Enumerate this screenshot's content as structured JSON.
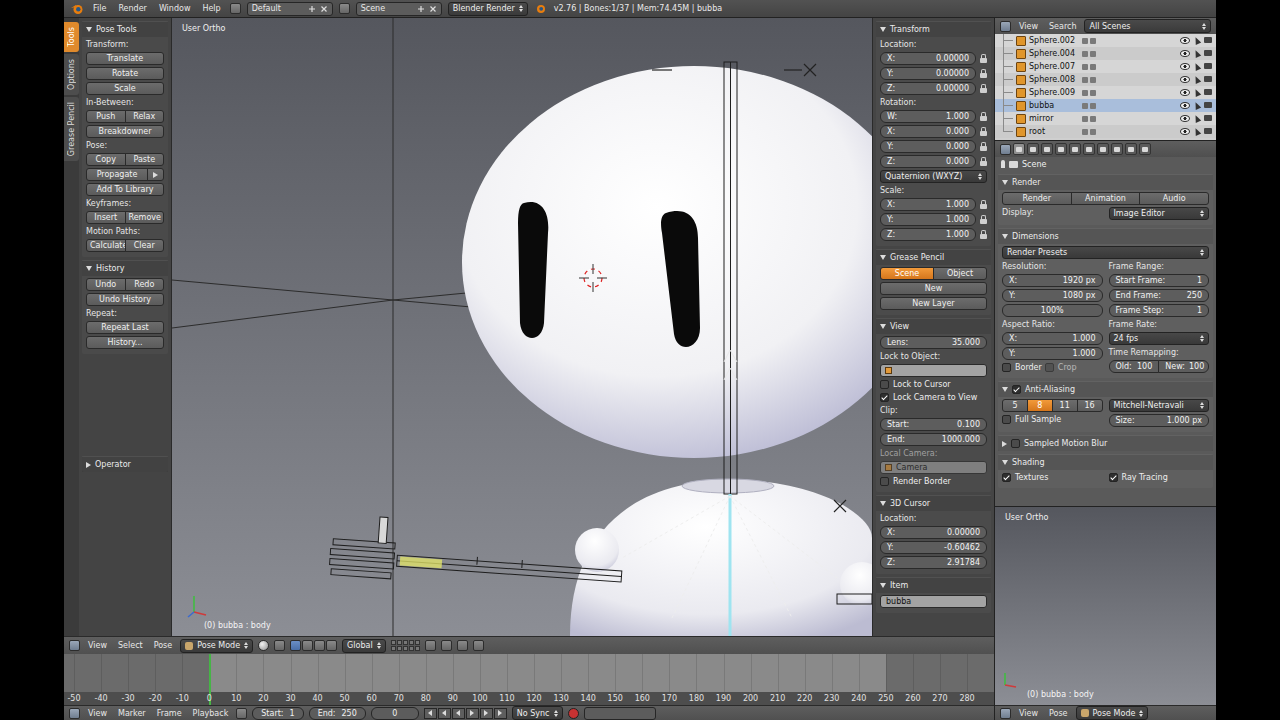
{
  "top_bar": {
    "menus": [
      "File",
      "Render",
      "Window",
      "Help"
    ],
    "layout": "Default",
    "scene": "Scene",
    "engine": "Blender Render",
    "info": "v2.76 | Bones:1/37 | Mem:74.45M | bubba"
  },
  "tool_tabs": [
    {
      "label": "Tools",
      "selected": true
    },
    {
      "label": "Options",
      "selected": false
    },
    {
      "label": "Grease Pencil",
      "selected": false
    }
  ],
  "tool_shelf": {
    "panels": [
      {
        "title": "Pose Tools",
        "expanded": true,
        "rows": [
          {
            "kind": "label",
            "text": "Transform:"
          },
          {
            "kind": "button",
            "text": "Translate",
            "selected": false
          },
          {
            "kind": "button",
            "text": "Rotate",
            "selected": false
          },
          {
            "kind": "button",
            "text": "Scale",
            "selected": false
          },
          {
            "kind": "label",
            "text": "In-Between:"
          },
          {
            "kind": "buttons",
            "items": [
              {
                "text": "Push",
                "selected": false
              },
              {
                "text": "Relax",
                "selected": false
              }
            ]
          },
          {
            "kind": "button",
            "text": "Breakdowner",
            "selected": false
          },
          {
            "kind": "label",
            "text": "Pose:"
          },
          {
            "kind": "buttons",
            "items": [
              {
                "text": "Copy",
                "selected": false
              },
              {
                "text": "Paste",
                "selected": false
              }
            ]
          },
          {
            "kind": "menu-button",
            "text": "Propagate"
          },
          {
            "kind": "button",
            "text": "Add To Library",
            "selected": false
          },
          {
            "kind": "label",
            "text": "Keyframes:"
          },
          {
            "kind": "buttons",
            "items": [
              {
                "text": "Insert",
                "selected": false
              },
              {
                "text": "Remove",
                "selected": false
              }
            ]
          },
          {
            "kind": "label",
            "text": "Motion Paths:"
          },
          {
            "kind": "buttons",
            "items": [
              {
                "text": "Calculate",
                "selected": false
              },
              {
                "text": "Clear",
                "selected": false
              }
            ]
          }
        ]
      },
      {
        "title": "History",
        "expanded": true,
        "rows": [
          {
            "kind": "buttons",
            "items": [
              {
                "text": "Undo",
                "selected": false
              },
              {
                "text": "Redo",
                "selected": false
              }
            ]
          },
          {
            "kind": "button",
            "text": "Undo History",
            "selected": false
          },
          {
            "kind": "label",
            "text": "Repeat:"
          },
          {
            "kind": "button",
            "text": "Repeat Last",
            "selected": false
          },
          {
            "kind": "button",
            "text": "History...",
            "selected": false
          }
        ]
      }
    ],
    "operator": {
      "title": "Operator",
      "expanded": false,
      "rows": []
    }
  },
  "viewport": {
    "title": "User Ortho",
    "status": "(0) bubba : body"
  },
  "n_panel": [
    {
      "title": "Transform",
      "expanded": true,
      "rows": [
        {
          "kind": "label",
          "text": "Location:"
        },
        {
          "kind": "field-lock",
          "label": "X:",
          "value": "0.00000"
        },
        {
          "kind": "field-lock",
          "label": "Y:",
          "value": "0.00000"
        },
        {
          "kind": "field-lock",
          "label": "Z:",
          "value": "0.00000"
        },
        {
          "kind": "label",
          "text": "Rotation:"
        },
        {
          "kind": "field-lock",
          "label": "W:",
          "value": "1.000"
        },
        {
          "kind": "field-lock",
          "label": "X:",
          "value": "0.000"
        },
        {
          "kind": "field-lock",
          "label": "Y:",
          "value": "0.000"
        },
        {
          "kind": "field-lock",
          "label": "Z:",
          "value": "0.000"
        },
        {
          "kind": "dropdown",
          "text": "Quaternion (WXYZ)"
        },
        {
          "kind": "label",
          "text": "Scale:"
        },
        {
          "kind": "field-lock",
          "label": "X:",
          "value": "1.000"
        },
        {
          "kind": "field-lock",
          "label": "Y:",
          "value": "1.000"
        },
        {
          "kind": "field-lock",
          "label": "Z:",
          "value": "1.000"
        }
      ]
    },
    {
      "title": "Grease Pencil",
      "expanded": true,
      "rows": [
        {
          "kind": "buttons",
          "items": [
            {
              "text": "Scene",
              "selected": true
            },
            {
              "text": "Object",
              "selected": false
            }
          ]
        },
        {
          "kind": "button",
          "text": "New",
          "selected": false
        },
        {
          "kind": "button",
          "text": "New Layer",
          "selected": false
        }
      ]
    },
    {
      "title": "View",
      "expanded": true,
      "rows": [
        {
          "kind": "field",
          "label": "Lens:",
          "value": "35.000"
        },
        {
          "kind": "label",
          "text": "Lock to Object:"
        },
        {
          "kind": "object-field",
          "value": "",
          "disabled": false
        },
        {
          "kind": "toggle",
          "text": "Lock to Cursor",
          "checked": false
        },
        {
          "kind": "toggle",
          "text": "Lock Camera to View",
          "checked": true
        },
        {
          "kind": "label",
          "text": "Clip:"
        },
        {
          "kind": "field",
          "label": "Start:",
          "value": "0.100"
        },
        {
          "kind": "field",
          "label": "End:",
          "value": "1000.000"
        },
        {
          "kind": "label",
          "text": "Local Camera:",
          "disabled": true
        },
        {
          "kind": "object-field",
          "value": "Camera",
          "disabled": true
        },
        {
          "kind": "toggle",
          "text": "Render Border",
          "checked": false
        }
      ]
    },
    {
      "title": "3D Cursor",
      "expanded": true,
      "rows": [
        {
          "kind": "label",
          "text": "Location:"
        },
        {
          "kind": "field",
          "label": "X:",
          "value": "0.00000"
        },
        {
          "kind": "field",
          "label": "Y:",
          "value": "-0.60462"
        },
        {
          "kind": "field",
          "label": "Z:",
          "value": "2.91784"
        }
      ]
    },
    {
      "title": "Item",
      "expanded": true,
      "rows": [
        {
          "kind": "text-field",
          "value": "bubba"
        }
      ]
    }
  ],
  "viewport_header": {
    "menus": [
      "View",
      "Select",
      "Pose"
    ],
    "mode": "Pose Mode",
    "orientation": "Global"
  },
  "timeline": {
    "ticks": [
      "-50",
      "-40",
      "-30",
      "-20",
      "-10",
      "0",
      "10",
      "20",
      "30",
      "40",
      "50",
      "60",
      "70",
      "80",
      "90",
      "100",
      "110",
      "120",
      "130",
      "140",
      "150",
      "160",
      "170",
      "180",
      "190",
      "200",
      "210",
      "220",
      "230",
      "240",
      "250",
      "260",
      "270",
      "280"
    ],
    "current": "0"
  },
  "timeline_header": {
    "menus": [
      "View",
      "Marker",
      "Frame",
      "Playback"
    ],
    "start_label": "Start:",
    "start": "1",
    "end_label": "End:",
    "end": "250",
    "frame": "0",
    "sync": "No Sync"
  },
  "outliner": {
    "menus": [
      "View",
      "Search"
    ],
    "filter": "All Scenes",
    "items": [
      {
        "name": "Sphere.002",
        "selected": false
      },
      {
        "name": "Sphere.004",
        "selected": false
      },
      {
        "name": "Sphere.007",
        "selected": false
      },
      {
        "name": "Sphere.008",
        "selected": false
      },
      {
        "name": "Sphere.009",
        "selected": false
      },
      {
        "name": "bubba",
        "selected": true
      },
      {
        "name": "mirror",
        "selected": false
      },
      {
        "name": "root",
        "selected": false
      }
    ]
  },
  "properties": {
    "tabs": [
      {
        "selected": true
      },
      {
        "selected": false
      },
      {
        "selected": false
      },
      {
        "selected": false
      },
      {
        "selected": false
      },
      {
        "selected": false
      },
      {
        "selected": false
      },
      {
        "selected": false
      },
      {
        "selected": false
      },
      {
        "selected": false
      }
    ],
    "breadcrumb": "Scene",
    "panels": [
      {
        "title": "Render",
        "expanded": true,
        "rows": [
          {
            "kind": "buttons",
            "items": [
              {
                "text": "Render",
                "selected": false
              },
              {
                "text": "Animation",
                "selected": false
              },
              {
                "text": "Audio",
                "selected": false
              }
            ]
          },
          {
            "kind": "columns",
            "columns": [
              [
                {
                  "kind": "label",
                  "text": "Display:"
                }
              ],
              [
                {
                  "kind": "dropdown",
                  "text": "Image Editor"
                }
              ]
            ]
          }
        ]
      },
      {
        "title": "Dimensions",
        "expanded": true,
        "rows": [
          {
            "kind": "dropdown",
            "text": "Render Presets"
          },
          {
            "kind": "columns",
            "columns": [
              [
                {
                  "kind": "label",
                  "text": "Resolution:"
                },
                {
                  "kind": "field",
                  "label": "X:",
                  "value": "1920 px"
                },
                {
                  "kind": "field",
                  "label": "Y:",
                  "value": "1080 px"
                },
                {
                  "kind": "field",
                  "label": "",
                  "value": "100%"
                }
              ],
              [
                {
                  "kind": "label",
                  "text": "Frame Range:"
                },
                {
                  "kind": "field",
                  "label": "Start Frame:",
                  "value": "1"
                },
                {
                  "kind": "field",
                  "label": "End Frame:",
                  "value": "250"
                },
                {
                  "kind": "field",
                  "label": "Frame Step:",
                  "value": "1"
                }
              ]
            ]
          },
          {
            "kind": "columns",
            "columns": [
              [
                {
                  "kind": "label",
                  "text": "Aspect Ratio:"
                },
                {
                  "kind": "field",
                  "label": "X:",
                  "value": "1.000"
                },
                {
                  "kind": "field",
                  "label": "Y:",
                  "value": "1.000"
                },
                {
                  "kind": "toggles",
                  "items": [
                    {
                      "text": "Border",
                      "checked": false,
                      "disabled": false
                    },
                    {
                      "text": "Crop",
                      "checked": false,
                      "disabled": true
                    }
                  ]
                }
              ],
              [
                {
                  "kind": "label",
                  "text": "Frame Rate:"
                },
                {
                  "kind": "dropdown",
                  "text": "24 fps"
                },
                {
                  "kind": "label",
                  "text": "Time Remapping:"
                },
                {
                  "kind": "fields",
                  "items": [
                    {
                      "label": "Old:",
                      "value": "100"
                    },
                    {
                      "label": "New:",
                      "value": "100"
                    }
                  ]
                }
              ]
            ]
          }
        ]
      },
      {
        "title": "Anti-Aliasing",
        "expanded": true,
        "checked": true,
        "rows": [
          {
            "kind": "columns",
            "columns": [
              [
                {
                  "kind": "buttons",
                  "items": [
                    {
                      "text": "5",
                      "selected": false
                    },
                    {
                      "text": "8",
                      "selected": true
                    },
                    {
                      "text": "11",
                      "selected": false
                    },
                    {
                      "text": "16",
                      "selected": false
                    }
                  ]
                }
              ],
              [
                {
                  "kind": "dropdown",
                  "text": "Mitchell-Netravali"
                }
              ]
            ]
          },
          {
            "kind": "columns",
            "columns": [
              [
                {
                  "kind": "toggle",
                  "text": "Full Sample",
                  "checked": false
                }
              ],
              [
                {
                  "kind": "field",
                  "label": "Size:",
                  "value": "1.000 px"
                }
              ]
            ]
          }
        ]
      },
      {
        "title": "Sampled Motion Blur",
        "expanded": false,
        "checked": false,
        "rows": []
      },
      {
        "title": "Shading",
        "expanded": true,
        "rows": [
          {
            "kind": "columns",
            "columns": [
              [
                {
                  "kind": "toggle",
                  "text": "Textures",
                  "checked": true
                }
              ],
              [
                {
                  "kind": "toggle",
                  "text": "Ray Tracing",
                  "checked": true
                }
              ]
            ]
          }
        ]
      }
    ]
  },
  "mini_view": {
    "title": "User Ortho",
    "status": "(0) bubba : body",
    "menus": [
      "View",
      "Pose"
    ],
    "mode": "Pose Mode"
  }
}
